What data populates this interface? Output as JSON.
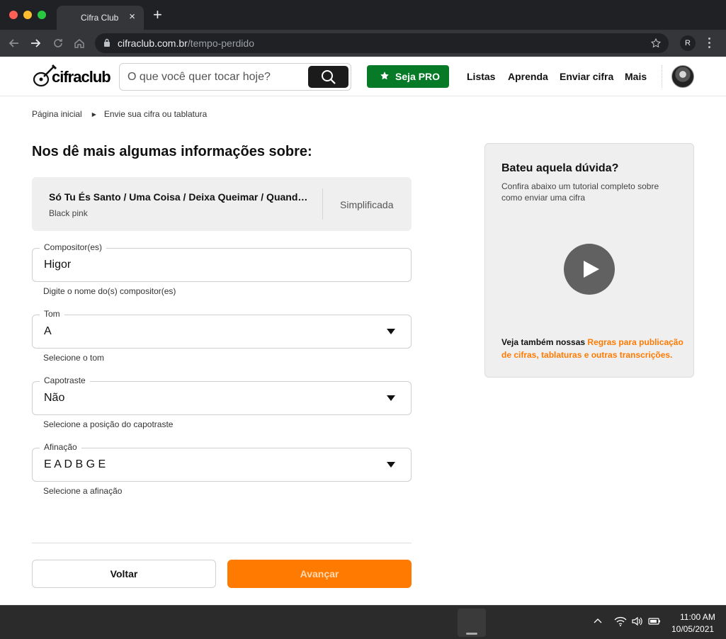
{
  "browser": {
    "tab_title": "Cifra Club",
    "tab_close": "×",
    "new_tab": "+",
    "url_host": "cifraclub.com.br",
    "url_path": "/tempo-perdido",
    "profile_initial": "R"
  },
  "header": {
    "logo_text": "cifraclub",
    "search_placeholder": "O que você quer tocar hoje?",
    "pro_label": "Seja PRO",
    "nav": [
      "Listas",
      "Aprenda",
      "Enviar cifra",
      "Mais"
    ],
    "brand_green": "#067a26",
    "brand_orange": "#ff7a00"
  },
  "breadcrumb": {
    "home": "Página inicial",
    "current": "Envie sua cifra ou tablatura"
  },
  "form": {
    "title": "Nos dê mais algumas informações sobre:",
    "song": {
      "title": "Só Tu És Santo / Uma Coisa / Deixa Queimar / Quando Eu Me Perco",
      "artist": "Black pink",
      "type": "Simplificada"
    },
    "fields": [
      {
        "label": "Compositor(es)",
        "value": "Higor",
        "hint": "Digite o nome do(s) compositor(es)"
      },
      {
        "label": "Tom",
        "value": "A",
        "hint": "Selecione o tom"
      },
      {
        "label": "Capotraste",
        "value": "Não",
        "hint": "Selecione a posição do capotraste"
      },
      {
        "label": "Afinação",
        "value": "E A D B G E",
        "hint": "Selecione a afinação"
      }
    ],
    "back_label": "Voltar",
    "next_label": "Avançar"
  },
  "help": {
    "title": "Bateu aquela dúvida?",
    "text": "Confira abaixo um tutorial completo sobre como enviar uma cifra",
    "foot_prefix": "Veja também nossas ",
    "foot_link": "Regras para publicação de cifras, tablaturas e outras transcrições."
  },
  "taskbar": {
    "time": "11:00 AM",
    "date": "10/05/2021"
  }
}
